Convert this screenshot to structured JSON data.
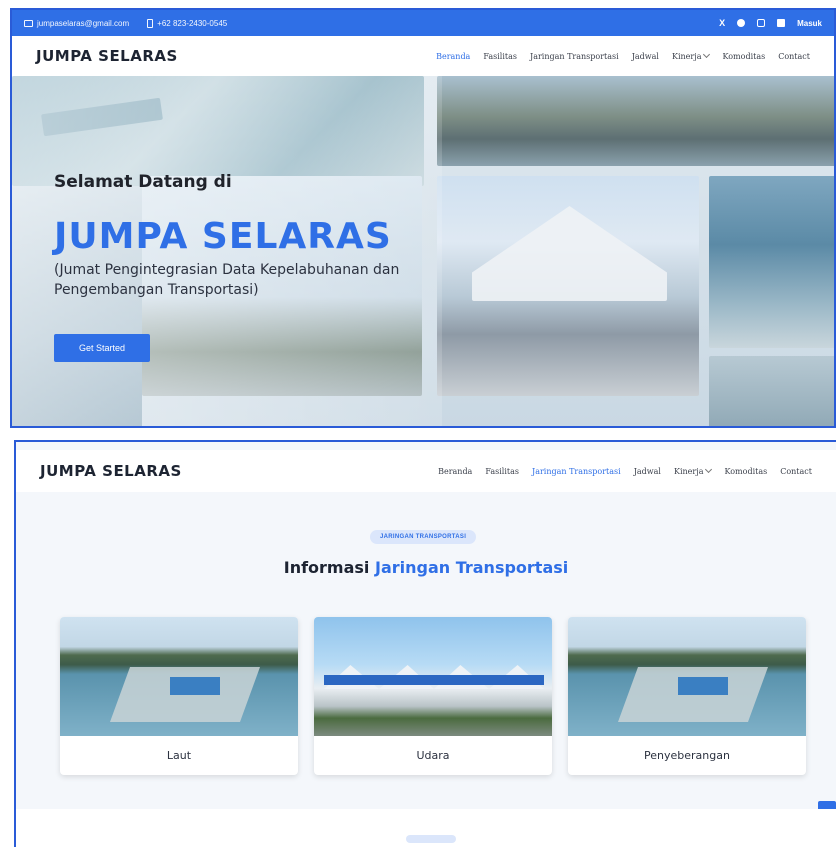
{
  "topbar": {
    "email": "jumpaselaras@gmail.com",
    "phone": "+62 823-2430-0545",
    "social": [
      "X",
      "facebook-icon",
      "instagram-icon",
      "linkedin-icon"
    ],
    "login": "Masuk"
  },
  "brand": "JUMPA SELARAS",
  "nav1": {
    "items": [
      "Beranda",
      "Fasilitas",
      "Jaringan Transportasi",
      "Jadwal",
      "Kinerja",
      "Komoditas",
      "Contact"
    ],
    "active_index": 0
  },
  "hero": {
    "welcome": "Selamat Datang di",
    "title": "JUMPA SELARAS",
    "subtitle": "(Jumat Pengintegrasian Data Kepelabuhanan dan Pengembangan Transportasi)",
    "cta": "Get Started"
  },
  "nav2": {
    "items": [
      "Beranda",
      "Fasilitas",
      "Jaringan Transportasi",
      "Jadwal",
      "Kinerja",
      "Komoditas",
      "Contact"
    ],
    "active_index": 2
  },
  "section": {
    "badge": "JARINGAN TRANSPORTASI",
    "title_plain": "Informasi",
    "title_highlight": "Jaringan Transportasi"
  },
  "cards": [
    {
      "label": "Laut"
    },
    {
      "label": "Udara"
    },
    {
      "label": "Penyeberangan"
    }
  ],
  "back_to_top": "↑",
  "colors": {
    "accent": "#2f6fe6",
    "text": "#1d2432",
    "section_bg": "#f4f7fb"
  }
}
